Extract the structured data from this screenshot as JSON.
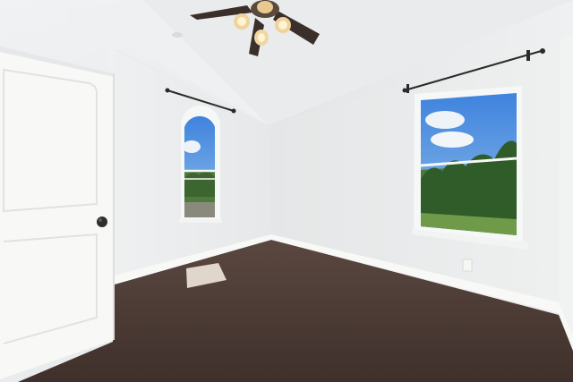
{
  "scene": {
    "kind": "empty-bedroom-interior",
    "elements": [
      "vaulted-ceiling",
      "ceiling-fan-with-lights",
      "arched-window",
      "rectangular-window",
      "curtain-rods",
      "white-panel-door",
      "door-knob",
      "brown-carpet",
      "white-baseboards",
      "electrical-outlet",
      "sunlight-patch"
    ],
    "colors": {
      "wall": "#e8eaeb",
      "ceiling": "#eceeef",
      "carpet": "#4a3a34",
      "trim": "#f7f7f5",
      "sky": "#4f8fe0",
      "trees": "#3f6b32"
    }
  }
}
